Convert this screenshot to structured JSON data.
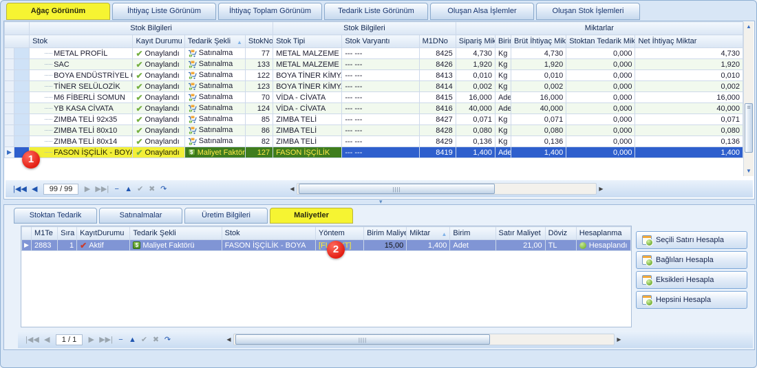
{
  "colors": {
    "selected_row_blue": "#2e5fcd",
    "bottom_selected_row": "#8095d5",
    "highlight_yellow": "#f2ef38",
    "highlight_green": "#3f7d1e",
    "tab_selected_yellow": "#f6f432",
    "status_green": "#8bc34a",
    "annotation_red": "#e31f14"
  },
  "top_tabs": [
    {
      "label": "Ağaç Görünüm",
      "selected": true
    },
    {
      "label": "İhtiyaç Liste Görünüm",
      "selected": false
    },
    {
      "label": "İhtiyaç Toplam Görünüm",
      "selected": false
    },
    {
      "label": "Tedarik Liste Görünüm",
      "selected": false
    },
    {
      "label": "Oluşan Alsa İşlemler",
      "selected": false
    },
    {
      "label": "Oluşan Stok İşlemleri",
      "selected": false
    }
  ],
  "top_grid": {
    "bands": [
      {
        "label": "Stok Bilgileri",
        "span": 4
      },
      {
        "label": "Stok Bilgileri",
        "span": 3
      },
      {
        "label": "Miktarlar",
        "span": 5
      }
    ],
    "columns": [
      {
        "label": "Stok"
      },
      {
        "label": "Kayıt Durumu"
      },
      {
        "label": "Tedarik Şekli",
        "sort": "asc"
      },
      {
        "label": "StokNo",
        "num": true
      },
      {
        "label": "Stok Tipi"
      },
      {
        "label": "Stok Varyantı"
      },
      {
        "label": "M1DNo",
        "num": true
      },
      {
        "label": "Sipariş Miktar",
        "num": true
      },
      {
        "label": "Birim"
      },
      {
        "label": "Brüt İhtiyaç Miktar",
        "num": true
      },
      {
        "label": "Stoktan Tedarik Miktar",
        "num": true
      },
      {
        "label": "Net İhtiyaç Miktar",
        "num": true
      }
    ],
    "rows": [
      {
        "stok": "METAL PROFİL",
        "kayit": "Onaylandı",
        "tedarik": "Satınalma",
        "tedarik_icon": "cart-icon",
        "stokno": "77",
        "tip": "METAL MALZEME",
        "varyant": "--- ---",
        "m1dno": "8425",
        "siparis": "4,730",
        "birim": "Kg",
        "brut": "4,730",
        "stoktan": "0,000",
        "net": "4,730",
        "selected": false
      },
      {
        "stok": "SAC",
        "kayit": "Onaylandı",
        "tedarik": "Satınalma",
        "tedarik_icon": "cart-icon",
        "stokno": "133",
        "tip": "METAL MALZEME",
        "varyant": "--- ---",
        "m1dno": "8426",
        "siparis": "1,920",
        "birim": "Kg",
        "brut": "1,920",
        "stoktan": "0,000",
        "net": "1,920",
        "selected": false
      },
      {
        "stok": "BOYA ENDÜSTRİYEL GR",
        "kayit": "Onaylandı",
        "tedarik": "Satınalma",
        "tedarik_icon": "cart-icon",
        "stokno": "122",
        "tip": "BOYA TİNER KİMYA",
        "varyant": "--- ---",
        "m1dno": "8413",
        "siparis": "0,010",
        "birim": "Kg",
        "brut": "0,010",
        "stoktan": "0,000",
        "net": "0,010",
        "selected": false
      },
      {
        "stok": "TİNER SELÜLOZİK",
        "kayit": "Onaylandı",
        "tedarik": "Satınalma",
        "tedarik_icon": "cart-icon",
        "stokno": "123",
        "tip": "BOYA TİNER KİMYA",
        "varyant": "--- ---",
        "m1dno": "8414",
        "siparis": "0,002",
        "birim": "Kg",
        "brut": "0,002",
        "stoktan": "0,000",
        "net": "0,002",
        "selected": false
      },
      {
        "stok": "M6 FİBERLİ SOMUN",
        "kayit": "Onaylandı",
        "tedarik": "Satınalma",
        "tedarik_icon": "cart-icon",
        "stokno": "70",
        "tip": "VİDA - CİVATA",
        "varyant": "--- ---",
        "m1dno": "8415",
        "siparis": "16,000",
        "birim": "Adet",
        "brut": "16,000",
        "stoktan": "0,000",
        "net": "16,000",
        "selected": false
      },
      {
        "stok": "YB KASA CİVATA",
        "kayit": "Onaylandı",
        "tedarik": "Satınalma",
        "tedarik_icon": "cart-icon",
        "stokno": "124",
        "tip": "VİDA - CİVATA",
        "varyant": "--- ---",
        "m1dno": "8416",
        "siparis": "40,000",
        "birim": "Adet",
        "brut": "40,000",
        "stoktan": "0,000",
        "net": "40,000",
        "selected": false
      },
      {
        "stok": "ZIMBA TELİ 92x35",
        "kayit": "Onaylandı",
        "tedarik": "Satınalma",
        "tedarik_icon": "cart-icon",
        "stokno": "85",
        "tip": "ZIMBA TELİ",
        "varyant": "--- ---",
        "m1dno": "8427",
        "siparis": "0,071",
        "birim": "Kg",
        "brut": "0,071",
        "stoktan": "0,000",
        "net": "0,071",
        "selected": false
      },
      {
        "stok": "ZIMBA TELİ 80x10",
        "kayit": "Onaylandı",
        "tedarik": "Satınalma",
        "tedarik_icon": "cart-icon",
        "stokno": "86",
        "tip": "ZIMBA TELİ",
        "varyant": "--- ---",
        "m1dno": "8428",
        "siparis": "0,080",
        "birim": "Kg",
        "brut": "0,080",
        "stoktan": "0,000",
        "net": "0,080",
        "selected": false
      },
      {
        "stok": "ZIMBA TELİ 80x14",
        "kayit": "Onaylandı",
        "tedarik": "Satınalma",
        "tedarik_icon": "cart-icon",
        "stokno": "82",
        "tip": "ZIMBA TELİ",
        "varyant": "--- ---",
        "m1dno": "8429",
        "siparis": "0,136",
        "birim": "Kg",
        "brut": "0,136",
        "stoktan": "0,000",
        "net": "0,136",
        "selected": false
      },
      {
        "stok": "FASON İŞÇİLİK - BOYA",
        "kayit": "Onaylandı",
        "tedarik": "Maliyet Faktörü",
        "tedarik_icon": "money-icon",
        "stokno": "127",
        "tip": "FASON İŞÇİLİK",
        "varyant": "--- ---",
        "m1dno": "8419",
        "siparis": "1,400",
        "birim": "Adet",
        "brut": "1,400",
        "stoktan": "0,000",
        "net": "1,400",
        "selected": true
      }
    ],
    "navigator": {
      "position": "99 / 99",
      "buttons": [
        {
          "name": "first-record-button",
          "glyph": "|◀◀",
          "enabled": true
        },
        {
          "name": "prior-record-button",
          "glyph": "◀",
          "enabled": true
        },
        {
          "name": "next-record-button",
          "glyph": "▶",
          "enabled": false
        },
        {
          "name": "last-record-button",
          "glyph": "▶▶|",
          "enabled": false
        },
        {
          "name": "delete-record-button",
          "glyph": "−",
          "enabled": true
        },
        {
          "name": "edit-record-button",
          "glyph": "▲",
          "enabled": true
        },
        {
          "name": "post-edit-button",
          "glyph": "✔",
          "enabled": false
        },
        {
          "name": "cancel-edit-button",
          "glyph": "✖",
          "enabled": false
        },
        {
          "name": "refresh-button",
          "glyph": "↷",
          "enabled": true
        }
      ]
    }
  },
  "bottom_panel": {
    "tabs": [
      {
        "label": "Stoktan Tedarik",
        "selected": false
      },
      {
        "label": "Satınalmalar",
        "selected": false
      },
      {
        "label": "Üretim Bilgileri",
        "selected": false
      },
      {
        "label": "Maliyetler",
        "selected": true
      }
    ],
    "grid": {
      "columns": [
        {
          "label": "M1Te"
        },
        {
          "label": "Sıra",
          "num": true
        },
        {
          "label": "KayıtDurumu"
        },
        {
          "label": "Tedarik Şekli"
        },
        {
          "label": "Stok"
        },
        {
          "label": "Yöntem"
        },
        {
          "label": "Birim Maliyet",
          "num": true
        },
        {
          "label": "Miktar",
          "num": true,
          "sort": "asc"
        },
        {
          "label": "Birim"
        },
        {
          "label": "Satır Maliyet",
          "num": true
        },
        {
          "label": "Döviz"
        },
        {
          "label": "Hesaplanma"
        }
      ],
      "row": {
        "m1te": "2883",
        "sira": "1",
        "kayit": "Aktif",
        "tedarik": "Maliyet Faktörü",
        "stok": "FASON İŞÇİLİK - BOYA",
        "yontem": "[FLMLYT]",
        "birim_maliyet": "15,00",
        "miktar": "1,400",
        "birim": "Adet",
        "satir_maliyet": "21,00",
        "doviz": "TL",
        "hesaplanma": "Hesaplandı"
      },
      "navigator": {
        "position": "1 / 1",
        "buttons": [
          {
            "name": "first-record-button",
            "glyph": "|◀◀",
            "enabled": false
          },
          {
            "name": "prior-record-button",
            "glyph": "◀",
            "enabled": false
          },
          {
            "name": "next-record-button",
            "glyph": "▶",
            "enabled": false
          },
          {
            "name": "last-record-button",
            "glyph": "▶▶|",
            "enabled": false
          },
          {
            "name": "delete-record-button",
            "glyph": "−",
            "enabled": true
          },
          {
            "name": "edit-record-button",
            "glyph": "▲",
            "enabled": true
          },
          {
            "name": "post-edit-button",
            "glyph": "✔",
            "enabled": false
          },
          {
            "name": "cancel-edit-button",
            "glyph": "✖",
            "enabled": false
          },
          {
            "name": "refresh-button",
            "glyph": "↷",
            "enabled": true
          }
        ]
      }
    },
    "action_buttons": [
      {
        "label": "Seçili Satırı Hesapla"
      },
      {
        "label": "Bağlıları Hesapla"
      },
      {
        "label": "Eksikleri Hesapla"
      },
      {
        "label": "Hepsini Hesapla"
      }
    ]
  },
  "annotations": [
    {
      "label": "1"
    },
    {
      "label": "2"
    }
  ]
}
